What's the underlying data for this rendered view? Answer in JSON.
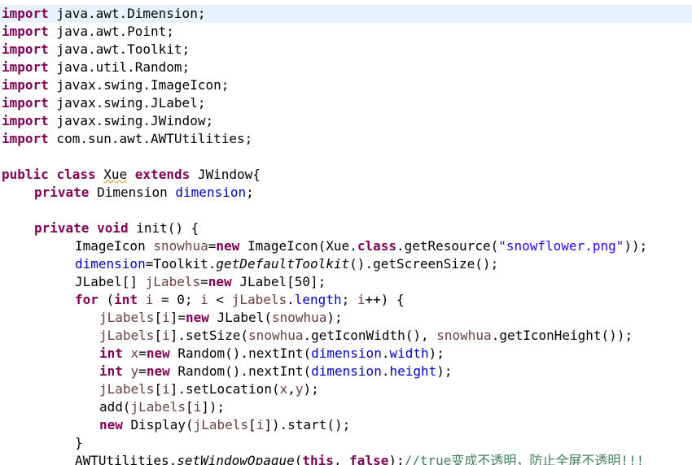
{
  "editor": {
    "current_line_color": "#e8f2fe",
    "colors": {
      "keyword": "#7f0055",
      "field": "#0000c0",
      "local_variable": "#6a3e3e",
      "string": "#2a00ff",
      "comment": "#3f7f5f",
      "plain": "#000000"
    },
    "lines": [
      {
        "indent": 0,
        "current": true,
        "tokens": [
          {
            "t": "import",
            "c": "kw"
          },
          {
            "t": " java.awt.Dimension;",
            "c": "pl"
          }
        ]
      },
      {
        "indent": 0,
        "tokens": [
          {
            "t": "import",
            "c": "kw"
          },
          {
            "t": " java.awt.Point;",
            "c": "pl"
          }
        ]
      },
      {
        "indent": 0,
        "tokens": [
          {
            "t": "import",
            "c": "kw"
          },
          {
            "t": " java.awt.Toolkit;",
            "c": "pl"
          }
        ]
      },
      {
        "indent": 0,
        "tokens": [
          {
            "t": "import",
            "c": "kw"
          },
          {
            "t": " java.util.Random;",
            "c": "pl"
          }
        ]
      },
      {
        "indent": 0,
        "tokens": [
          {
            "t": "import",
            "c": "kw"
          },
          {
            "t": " javax.swing.ImageIcon;",
            "c": "pl"
          }
        ]
      },
      {
        "indent": 0,
        "tokens": [
          {
            "t": "import",
            "c": "kw"
          },
          {
            "t": " javax.swing.JLabel;",
            "c": "pl"
          }
        ]
      },
      {
        "indent": 0,
        "tokens": [
          {
            "t": "import",
            "c": "kw"
          },
          {
            "t": " javax.swing.JWindow;",
            "c": "pl"
          }
        ]
      },
      {
        "indent": 0,
        "tokens": [
          {
            "t": "import",
            "c": "kw"
          },
          {
            "t": " com.sun.awt.AWTUtilities;",
            "c": "pl"
          }
        ]
      },
      {
        "indent": 0,
        "tokens": []
      },
      {
        "indent": 0,
        "tokens": [
          {
            "t": "public",
            "c": "kw"
          },
          {
            "t": " ",
            "c": "pl"
          },
          {
            "t": "class",
            "c": "kw"
          },
          {
            "t": " ",
            "c": "pl"
          },
          {
            "t": "Xue",
            "c": "pl sq"
          },
          {
            "t": " ",
            "c": "pl"
          },
          {
            "t": "extends",
            "c": "kw"
          },
          {
            "t": " JWindow{",
            "c": "pl"
          }
        ]
      },
      {
        "indent": 40,
        "tokens": [
          {
            "t": "private",
            "c": "kw"
          },
          {
            "t": " Dimension ",
            "c": "pl"
          },
          {
            "t": "dimension",
            "c": "fld"
          },
          {
            "t": ";",
            "c": "pl"
          }
        ]
      },
      {
        "indent": 0,
        "tokens": []
      },
      {
        "indent": 40,
        "tokens": [
          {
            "t": "private",
            "c": "kw"
          },
          {
            "t": " ",
            "c": "pl"
          },
          {
            "t": "void",
            "c": "kw"
          },
          {
            "t": " init() {",
            "c": "pl"
          }
        ]
      },
      {
        "indent": 90,
        "tokens": [
          {
            "t": "ImageIcon ",
            "c": "pl"
          },
          {
            "t": "snowhua",
            "c": "lv"
          },
          {
            "t": "=",
            "c": "pl"
          },
          {
            "t": "new",
            "c": "kw"
          },
          {
            "t": " ImageIcon(Xue.",
            "c": "pl"
          },
          {
            "t": "class",
            "c": "kw"
          },
          {
            "t": ".getResource(",
            "c": "pl"
          },
          {
            "t": "\"snowflower.png\"",
            "c": "str"
          },
          {
            "t": "));",
            "c": "pl"
          }
        ]
      },
      {
        "indent": 90,
        "tokens": [
          {
            "t": "dimension",
            "c": "fld"
          },
          {
            "t": "=Toolkit.",
            "c": "pl"
          },
          {
            "t": "getDefaultToolkit",
            "c": "it"
          },
          {
            "t": "().getScreenSize();",
            "c": "pl"
          }
        ]
      },
      {
        "indent": 90,
        "tokens": [
          {
            "t": "JLabel[] ",
            "c": "pl"
          },
          {
            "t": "jLabels",
            "c": "lv"
          },
          {
            "t": "=",
            "c": "pl"
          },
          {
            "t": "new",
            "c": "kw"
          },
          {
            "t": " JLabel[50];",
            "c": "pl"
          }
        ]
      },
      {
        "indent": 90,
        "tokens": [
          {
            "t": "for",
            "c": "kw"
          },
          {
            "t": " (",
            "c": "pl"
          },
          {
            "t": "int",
            "c": "kw"
          },
          {
            "t": " ",
            "c": "pl"
          },
          {
            "t": "i",
            "c": "lv"
          },
          {
            "t": " = 0; ",
            "c": "pl"
          },
          {
            "t": "i",
            "c": "lv"
          },
          {
            "t": " < ",
            "c": "pl"
          },
          {
            "t": "jLabels",
            "c": "lv"
          },
          {
            "t": ".",
            "c": "pl"
          },
          {
            "t": "length",
            "c": "fld"
          },
          {
            "t": "; ",
            "c": "pl"
          },
          {
            "t": "i",
            "c": "lv"
          },
          {
            "t": "++) {",
            "c": "pl"
          }
        ]
      },
      {
        "indent": 120,
        "tokens": [
          {
            "t": "jLabels",
            "c": "lv"
          },
          {
            "t": "[",
            "c": "pl"
          },
          {
            "t": "i",
            "c": "lv"
          },
          {
            "t": "]=",
            "c": "pl"
          },
          {
            "t": "new",
            "c": "kw"
          },
          {
            "t": " JLabel(",
            "c": "pl"
          },
          {
            "t": "snowhua",
            "c": "lv"
          },
          {
            "t": ");",
            "c": "pl"
          }
        ]
      },
      {
        "indent": 120,
        "tokens": [
          {
            "t": "jLabels",
            "c": "lv"
          },
          {
            "t": "[",
            "c": "pl"
          },
          {
            "t": "i",
            "c": "lv"
          },
          {
            "t": "].setSize(",
            "c": "pl"
          },
          {
            "t": "snowhua",
            "c": "lv"
          },
          {
            "t": ".getIconWidth(), ",
            "c": "pl"
          },
          {
            "t": "snowhua",
            "c": "lv"
          },
          {
            "t": ".getIconHeight());",
            "c": "pl"
          }
        ]
      },
      {
        "indent": 120,
        "tokens": [
          {
            "t": "int",
            "c": "kw"
          },
          {
            "t": " ",
            "c": "pl"
          },
          {
            "t": "x",
            "c": "lv"
          },
          {
            "t": "=",
            "c": "pl"
          },
          {
            "t": "new",
            "c": "kw"
          },
          {
            "t": " Random().nextInt(",
            "c": "pl"
          },
          {
            "t": "dimension",
            "c": "fld"
          },
          {
            "t": ".",
            "c": "pl"
          },
          {
            "t": "width",
            "c": "fld"
          },
          {
            "t": ");",
            "c": "pl"
          }
        ]
      },
      {
        "indent": 120,
        "tokens": [
          {
            "t": "int",
            "c": "kw"
          },
          {
            "t": " ",
            "c": "pl"
          },
          {
            "t": "y",
            "c": "lv"
          },
          {
            "t": "=",
            "c": "pl"
          },
          {
            "t": "new",
            "c": "kw"
          },
          {
            "t": " Random().nextInt(",
            "c": "pl"
          },
          {
            "t": "dimension",
            "c": "fld"
          },
          {
            "t": ".",
            "c": "pl"
          },
          {
            "t": "height",
            "c": "fld"
          },
          {
            "t": ");",
            "c": "pl"
          }
        ]
      },
      {
        "indent": 120,
        "tokens": [
          {
            "t": "jLabels",
            "c": "lv"
          },
          {
            "t": "[",
            "c": "pl"
          },
          {
            "t": "i",
            "c": "lv"
          },
          {
            "t": "].setLocation(",
            "c": "pl"
          },
          {
            "t": "x",
            "c": "lv"
          },
          {
            "t": ",",
            "c": "pl"
          },
          {
            "t": "y",
            "c": "lv"
          },
          {
            "t": ");",
            "c": "pl"
          }
        ]
      },
      {
        "indent": 120,
        "tokens": [
          {
            "t": "add(",
            "c": "pl"
          },
          {
            "t": "jLabels",
            "c": "lv"
          },
          {
            "t": "[",
            "c": "pl"
          },
          {
            "t": "i",
            "c": "lv"
          },
          {
            "t": "]);",
            "c": "pl"
          }
        ]
      },
      {
        "indent": 120,
        "tokens": [
          {
            "t": "new",
            "c": "kw"
          },
          {
            "t": " Display(",
            "c": "pl"
          },
          {
            "t": "jLabels",
            "c": "lv"
          },
          {
            "t": "[",
            "c": "pl"
          },
          {
            "t": "i",
            "c": "lv"
          },
          {
            "t": "]).start();",
            "c": "pl"
          }
        ]
      },
      {
        "indent": 90,
        "tokens": [
          {
            "t": "}",
            "c": "pl"
          }
        ]
      },
      {
        "indent": 90,
        "tokens": [
          {
            "t": "AWTUtilities.",
            "c": "pl"
          },
          {
            "t": "setWindowOpaque",
            "c": "it"
          },
          {
            "t": "(",
            "c": "pl"
          },
          {
            "t": "this",
            "c": "kw"
          },
          {
            "t": ", ",
            "c": "pl"
          },
          {
            "t": "false",
            "c": "kw"
          },
          {
            "t": ");",
            "c": "pl"
          },
          {
            "t": "//true变成不透明，防止全屏不透明!!!",
            "c": "cmt"
          }
        ]
      }
    ]
  }
}
